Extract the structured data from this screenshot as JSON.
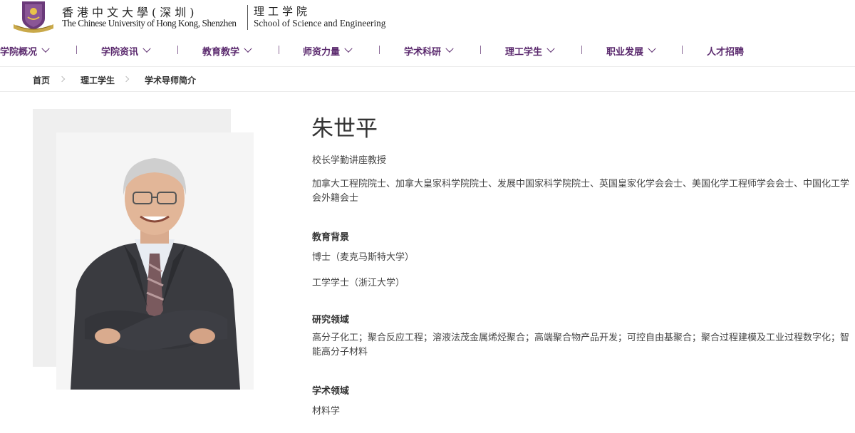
{
  "header": {
    "university_cn": "香港中文大學(深圳)",
    "university_en": "The Chinese University of Hong Kong, Shenzhen",
    "school_cn": "理工学院",
    "school_en": "School of Science and Engineering",
    "brand_color": "#5b2a6e",
    "logo_icon": "university-crest-icon"
  },
  "nav": {
    "items": [
      {
        "label": "学院概况",
        "has_dropdown": true
      },
      {
        "label": "学院资讯",
        "has_dropdown": true
      },
      {
        "label": "教育教学",
        "has_dropdown": true
      },
      {
        "label": "师资力量",
        "has_dropdown": true
      },
      {
        "label": "学术科研",
        "has_dropdown": true
      },
      {
        "label": "理工学生",
        "has_dropdown": true
      },
      {
        "label": "职业发展",
        "has_dropdown": true
      },
      {
        "label": "人才招聘",
        "has_dropdown": false
      }
    ]
  },
  "breadcrumb": [
    "首页",
    "理工学生",
    "学术导师简介"
  ],
  "profile": {
    "name": "朱世平",
    "title": "校长学勤讲座教授",
    "honors": "加拿大工程院院士、加拿大皇家科学院院士、发展中国家科学院院士、英国皇家化学会会士、美国化学工程师学会会士、中国化工学会外籍会士",
    "education_heading": "教育背景",
    "education": [
      "博士（麦克马斯特大学）",
      "工学学士（浙江大学）"
    ],
    "research_heading": "研究领域",
    "research": "高分子化工；聚合反应工程；溶液法茂金属烯烃聚合；高端聚合物产品开发；可控自由基聚合；聚合过程建模及工业过程数字化；智能高分子材料",
    "academic_heading": "学术领域",
    "academic": "材料学"
  }
}
